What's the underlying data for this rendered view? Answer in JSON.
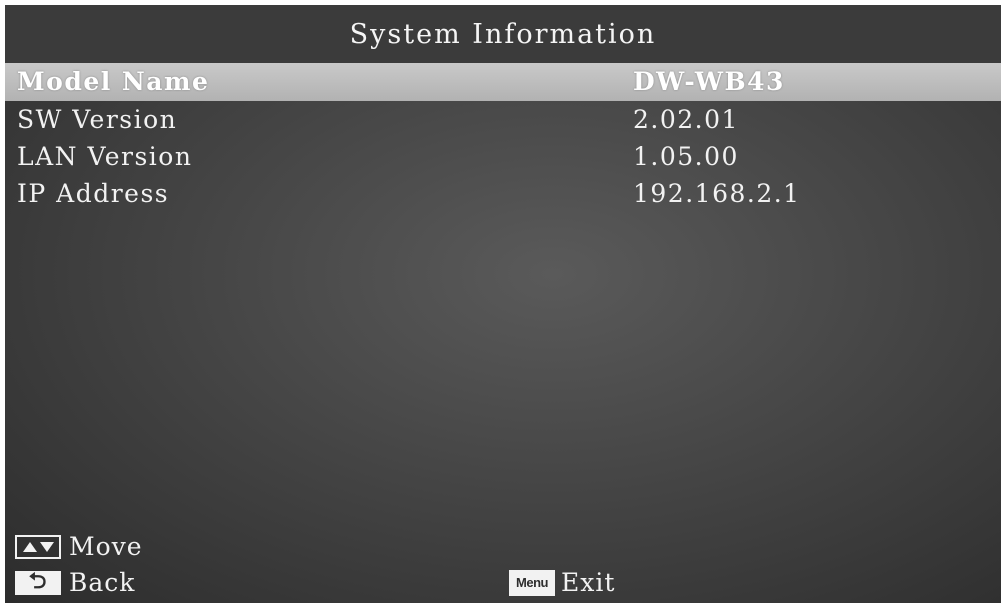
{
  "title": "System Information",
  "rows": [
    {
      "label": "Model Name",
      "value": "DW-WB43",
      "selected": true
    },
    {
      "label": "SW Version",
      "value": "2.02.01"
    },
    {
      "label": "LAN Version",
      "value": "1.05.00"
    },
    {
      "label": "IP Address",
      "value": "192.168.2.1"
    }
  ],
  "footer": {
    "move_label": "Move",
    "move_icon": "up-down-arrows-icon",
    "back_label": "Back",
    "back_icon": "return-icon",
    "back_glyph": "⮌",
    "menu_key": "Menu",
    "exit_label": "Exit"
  },
  "colors": {
    "highlight": "#c0c0c0",
    "background": "#4a4a4a",
    "text": "#f2f2f2"
  }
}
